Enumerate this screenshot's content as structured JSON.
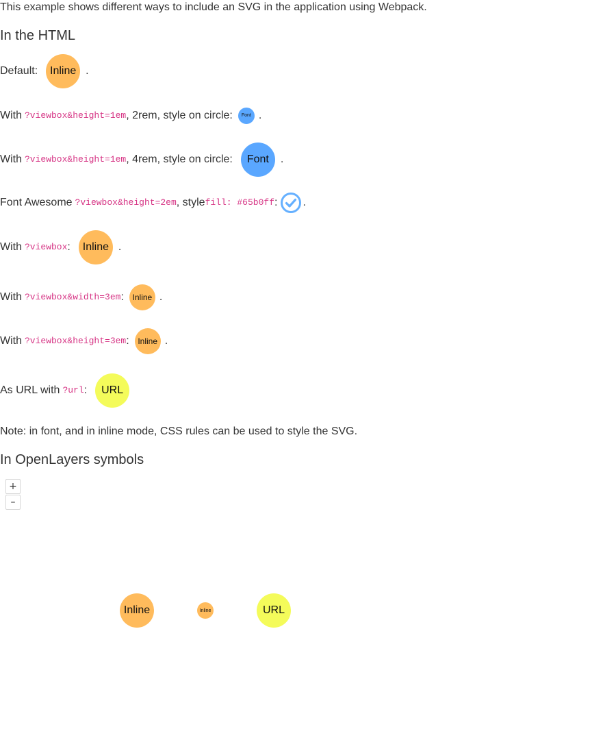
{
  "intro": "This example shows different ways to include an SVG in the application using Webpack.",
  "section_html": "In the HTML",
  "rows": {
    "default": {
      "prefix": "Default:",
      "circle": "Inline",
      "suffix": "."
    },
    "r2": {
      "prefix": "With ",
      "code": "?viewbox&height=1em",
      "mid": ", 2rem, style on circle:",
      "circle": "Font",
      "suffix": "."
    },
    "r3": {
      "prefix": "With ",
      "code": "?viewbox&height=1em",
      "mid": ", 4rem, style on circle:",
      "circle": "Font",
      "suffix": "."
    },
    "r4": {
      "prefix": "Font Awesome ",
      "code": "?viewbox&height=2em",
      "mid": ", style ",
      "code2": "fill: #65b0ff",
      "colon": ":",
      "icon": "check-circle-icon",
      "suffix": "."
    },
    "r5": {
      "prefix": "With ",
      "code": "?viewbox",
      "colon": ":",
      "circle": "Inline",
      "suffix": "."
    },
    "r6": {
      "prefix": "With ",
      "code": "?viewbox&width=3em",
      "colon": ":",
      "circle": "Inline",
      "suffix": "."
    },
    "r7": {
      "prefix": "With ",
      "code": "?viewbox&height=3em",
      "colon": ":",
      "circle": "Inline",
      "suffix": "."
    },
    "r8": {
      "prefix": "As URL with ",
      "code": "?url",
      "colon": ":",
      "circle": "URL"
    }
  },
  "note": "Note: in font, and in inline mode, CSS rules can be used to style the SVG.",
  "section_ol": "In OpenLayers symbols",
  "map": {
    "zoom_in": "+",
    "zoom_out": "–",
    "symbols": [
      "Inline",
      "Inline",
      "URL"
    ]
  },
  "colors": {
    "orange": "#ffbb5c",
    "blue": "#5aa7ff",
    "yellow": "#f4fb5a",
    "code": "#d63384",
    "fa_fill": "#65b0ff"
  }
}
